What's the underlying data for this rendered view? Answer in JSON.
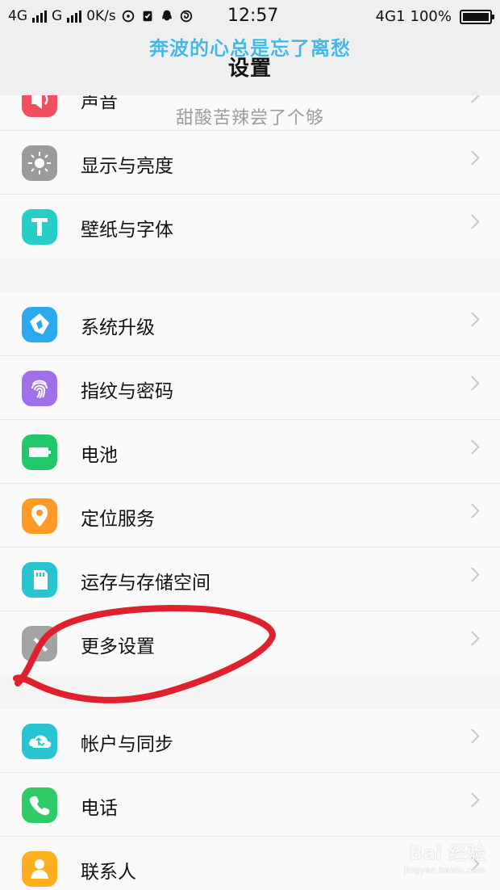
{
  "status_bar": {
    "net1": "4G",
    "net2": "G",
    "speed": "0K/s",
    "time": "12:57",
    "net3": "4G1",
    "battery": "100%"
  },
  "header": {
    "title": "设置"
  },
  "overlay": {
    "line1": "奔波的心总是忘了离愁",
    "line2": "甜酸苦辣尝了个够"
  },
  "sections": [
    {
      "items": [
        {
          "label": "声音",
          "icon": "sound-icon"
        },
        {
          "label": "显示与亮度",
          "icon": "display-icon"
        },
        {
          "label": "壁纸与字体",
          "icon": "font-icon"
        }
      ]
    },
    {
      "items": [
        {
          "label": "系统升级",
          "icon": "update-icon"
        },
        {
          "label": "指纹与密码",
          "icon": "fingerprint-icon"
        },
        {
          "label": "电池",
          "icon": "battery-icon"
        },
        {
          "label": "定位服务",
          "icon": "location-icon"
        },
        {
          "label": "运存与存储空间",
          "icon": "storage-icon"
        },
        {
          "label": "更多设置",
          "icon": "more-settings-icon"
        }
      ]
    },
    {
      "items": [
        {
          "label": "帐户与同步",
          "icon": "sync-icon"
        },
        {
          "label": "电话",
          "icon": "phone-icon"
        },
        {
          "label": "联系人",
          "icon": "contacts-icon"
        }
      ]
    }
  ],
  "watermark": {
    "main": "Bai 经验",
    "sub": "jingyan.baidu.com"
  },
  "colors": {
    "accent": "#45b7e6",
    "annotation": "#e0202a"
  }
}
